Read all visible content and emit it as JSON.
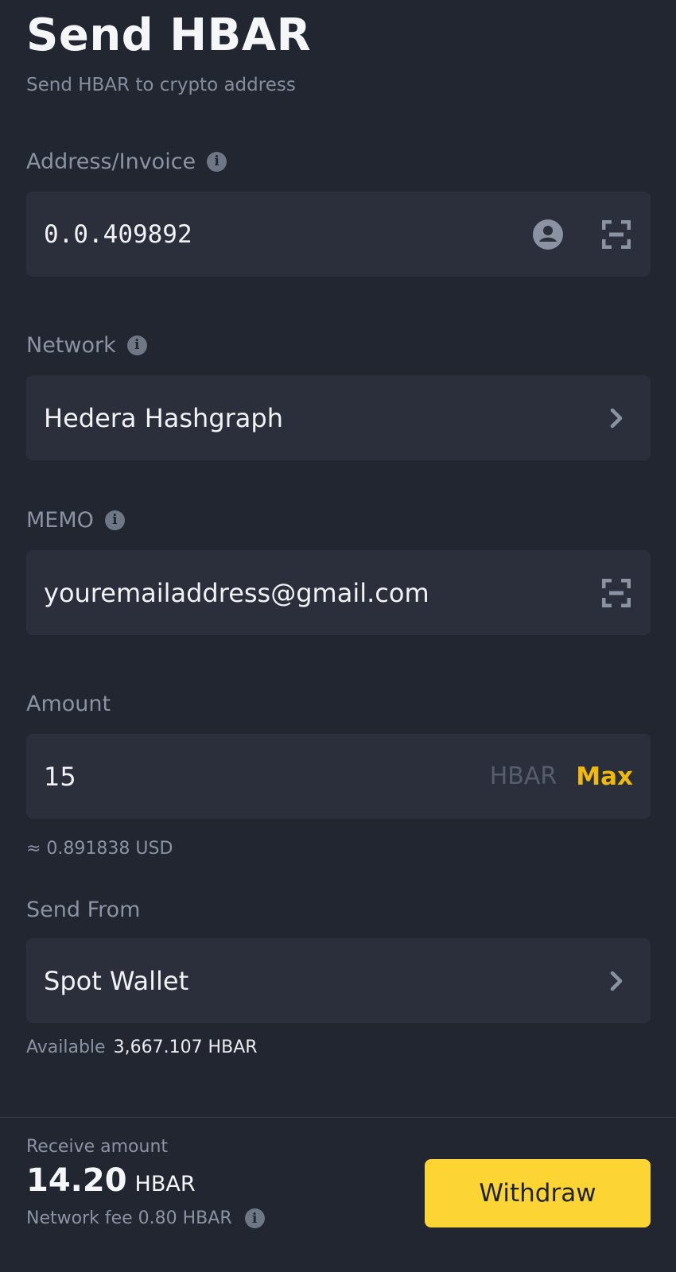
{
  "header": {
    "title": "Send HBAR",
    "subtitle": "Send HBAR to crypto address"
  },
  "address": {
    "label": "Address/Invoice",
    "info_glyph": "i",
    "value": "0.0.409892",
    "icons": [
      "account-circle-icon",
      "scan-icon"
    ]
  },
  "network": {
    "label": "Network",
    "info_glyph": "i",
    "value": "Hedera Hashgraph",
    "icon": "chevron-right-icon"
  },
  "memo": {
    "label": "MEMO",
    "info_glyph": "i",
    "value": "youremailaddress@gmail.com",
    "icon": "scan-icon"
  },
  "amount": {
    "label": "Amount",
    "value": "15",
    "unit": "HBAR",
    "max_label": "Max",
    "usd_estimate": "≈ 0.891838 USD"
  },
  "send_from": {
    "label": "Send From",
    "value": "Spot Wallet",
    "icon": "chevron-right-icon",
    "available_label": "Available",
    "available_value": "3,667.107 HBAR"
  },
  "footer": {
    "receive_label": "Receive amount",
    "receive_amount": "14.20",
    "receive_currency": "HBAR",
    "fee_text": "Network fee 0.80 HBAR",
    "info_glyph": "i",
    "withdraw_label": "Withdraw"
  },
  "colors": {
    "background": "#222631",
    "field_background": "#2a2f3b",
    "accent_yellow": "#fcd535",
    "max_text": "#f0b90b",
    "muted_text": "#8b93a2"
  }
}
